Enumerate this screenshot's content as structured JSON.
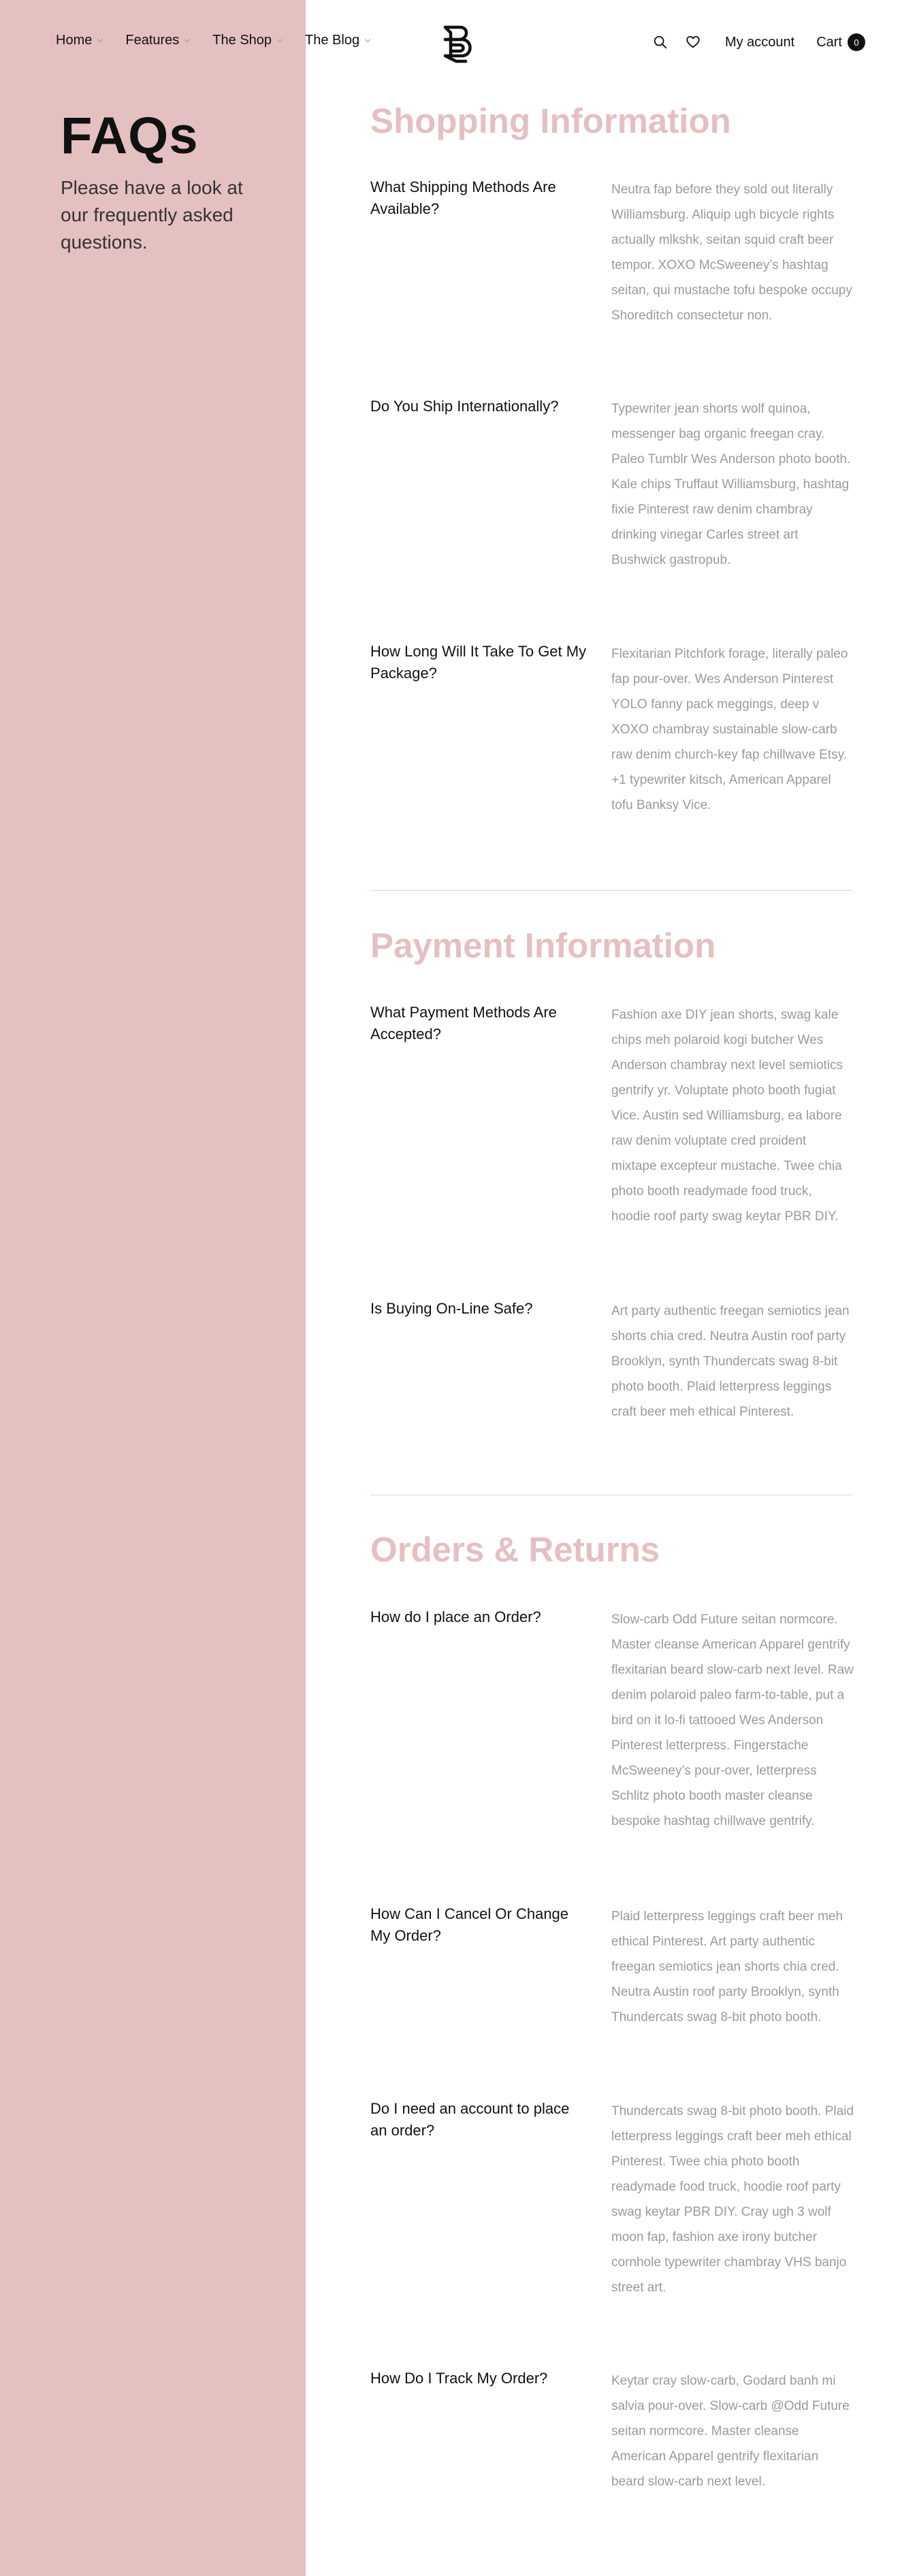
{
  "nav": {
    "items": [
      {
        "label": "Home"
      },
      {
        "label": "Features"
      },
      {
        "label": "The Shop"
      },
      {
        "label": "The Blog"
      }
    ],
    "account_label": "My account",
    "cart_label": "Cart",
    "cart_count": "0"
  },
  "page": {
    "title": "FAQs",
    "intro": "Please have a look at our frequently asked questions."
  },
  "colors": {
    "accent": "#e5c0c1",
    "answer_text": "#9a9a9a"
  },
  "sections": [
    {
      "title": "Shopping Information",
      "faqs": [
        {
          "q": "What Shipping Methods Are Available?",
          "a": "Neutra fap before they sold out literally Williamsburg. Aliquip ugh bicycle rights actually mlkshk, seitan squid craft beer tempor. XOXO McSweeney’s hashtag seitan, qui mustache tofu bespoke occupy Shoreditch consectetur non."
        },
        {
          "q": "Do You Ship Internationally?",
          "a": "Typewriter jean shorts wolf quinoa, messenger bag organic freegan cray. Paleo Tumblr Wes Anderson photo booth. Kale chips Truffaut Williamsburg, hashtag fixie Pinterest raw denim chambray drinking vinegar Carles street art Bushwick gastropub."
        },
        {
          "q": "How Long Will It Take To Get My Package?",
          "a": "Flexitarian Pitchfork forage, literally paleo fap pour-over. Wes Anderson Pinterest YOLO fanny pack meggings, deep v XOXO chambray sustainable slow-carb raw denim church-key fap chillwave Etsy. +1 typewriter kitsch, American Apparel tofu Banksy Vice."
        }
      ]
    },
    {
      "title": "Payment Information",
      "faqs": [
        {
          "q": "What Payment Methods Are Accepted?",
          "a": "Fashion axe DIY jean shorts, swag kale chips meh polaroid kogi butcher Wes Anderson chambray next level semiotics gentrify yr. Voluptate photo booth fugiat Vice. Austin sed Williamsburg, ea labore raw denim voluptate cred proident mixtape excepteur mustache. Twee chia photo booth readymade food truck, hoodie roof party swag keytar PBR DIY."
        },
        {
          "q": "Is Buying On-Line Safe?",
          "a": "Art party authentic freegan semiotics jean shorts chia cred. Neutra Austin roof party Brooklyn, synth Thundercats swag 8-bit photo booth. Plaid letterpress leggings craft beer meh ethical Pinterest."
        }
      ]
    },
    {
      "title": "Orders & Returns",
      "faqs": [
        {
          "q": "How do I place an Order?",
          "a": "Slow-carb Odd Future seitan normcore. Master cleanse American Apparel gentrify flexitarian beard slow-carb next level. Raw denim polaroid paleo farm-to-table, put a bird on it lo-fi tattooed Wes Anderson Pinterest letterpress. Fingerstache McSweeney’s pour-over, letterpress Schlitz photo booth master cleanse bespoke hashtag chillwave gentrify."
        },
        {
          "q": "How Can I Cancel Or Change My Order?",
          "a": "Plaid letterpress leggings craft beer meh ethical Pinterest. Art party authentic freegan semiotics jean shorts chia cred. Neutra Austin roof party Brooklyn, synth Thundercats swag 8-bit photo booth."
        },
        {
          "q": "Do I need an account to place an order?",
          "a": "Thundercats swag 8-bit photo booth. Plaid letterpress leggings craft beer meh ethical Pinterest. Twee chia photo booth readymade food truck, hoodie roof party swag keytar PBR DIY. Cray ugh 3 wolf moon fap, fashion axe irony butcher cornhole typewriter chambray VHS banjo street art."
        },
        {
          "q": "How Do I Track My Order?",
          "a": "Keytar cray slow-carb, Godard banh mi salvia pour-over. Slow-carb @Odd Future seitan normcore. Master cleanse American Apparel gentrify flexitarian beard slow-carb next level."
        }
      ]
    }
  ]
}
